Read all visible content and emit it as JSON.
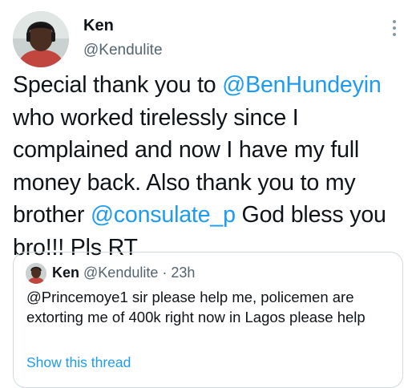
{
  "tweet": {
    "author": {
      "display_name": "Ken",
      "handle": "@Kendulite",
      "avatar": "profile-photo"
    },
    "menu_icon": "more-vertical-icon",
    "text_parts": [
      {
        "text": "Special thank you to ",
        "type": "text"
      },
      {
        "text": "@BenHundeyin",
        "type": "mention"
      },
      {
        "text": " who worked tirelessly since I complained and now I have my full money back. Also thank you to my brother ",
        "type": "text"
      },
      {
        "text": "@consulate_p",
        "type": "mention"
      },
      {
        "text": " God bless you bro!!! Pls RT",
        "type": "text"
      }
    ],
    "quoted_tweet": {
      "display_name": "Ken",
      "handle": "@Kendulite",
      "separator": "·",
      "time": "23h",
      "text": "@Princemoye1 sir please help me, policemen are extorting me of 400k right now in Lagos please help",
      "show_thread_label": "Show this thread"
    }
  },
  "colors": {
    "text": "#0f1419",
    "secondary": "#536471",
    "link": "#1d9bf0",
    "border": "#cfd9de"
  }
}
